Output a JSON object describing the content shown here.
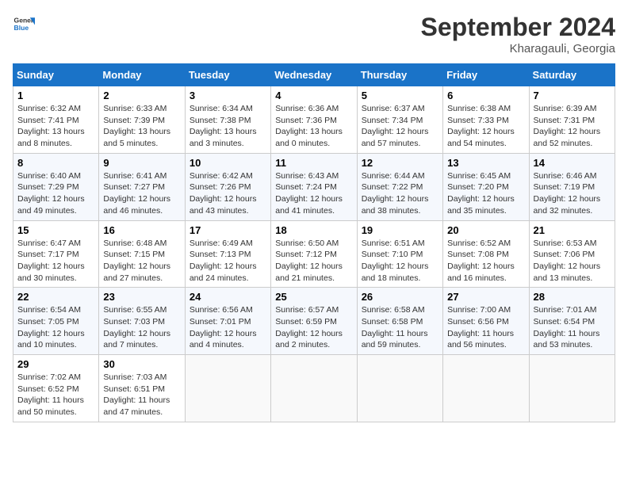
{
  "header": {
    "logo_line1": "General",
    "logo_line2": "Blue",
    "month_title": "September 2024",
    "subtitle": "Kharagauli, Georgia"
  },
  "weekdays": [
    "Sunday",
    "Monday",
    "Tuesday",
    "Wednesday",
    "Thursday",
    "Friday",
    "Saturday"
  ],
  "weeks": [
    [
      {
        "day": "1",
        "info": "Sunrise: 6:32 AM\nSunset: 7:41 PM\nDaylight: 13 hours and 8 minutes."
      },
      {
        "day": "2",
        "info": "Sunrise: 6:33 AM\nSunset: 7:39 PM\nDaylight: 13 hours and 5 minutes."
      },
      {
        "day": "3",
        "info": "Sunrise: 6:34 AM\nSunset: 7:38 PM\nDaylight: 13 hours and 3 minutes."
      },
      {
        "day": "4",
        "info": "Sunrise: 6:36 AM\nSunset: 7:36 PM\nDaylight: 13 hours and 0 minutes."
      },
      {
        "day": "5",
        "info": "Sunrise: 6:37 AM\nSunset: 7:34 PM\nDaylight: 12 hours and 57 minutes."
      },
      {
        "day": "6",
        "info": "Sunrise: 6:38 AM\nSunset: 7:33 PM\nDaylight: 12 hours and 54 minutes."
      },
      {
        "day": "7",
        "info": "Sunrise: 6:39 AM\nSunset: 7:31 PM\nDaylight: 12 hours and 52 minutes."
      }
    ],
    [
      {
        "day": "8",
        "info": "Sunrise: 6:40 AM\nSunset: 7:29 PM\nDaylight: 12 hours and 49 minutes."
      },
      {
        "day": "9",
        "info": "Sunrise: 6:41 AM\nSunset: 7:27 PM\nDaylight: 12 hours and 46 minutes."
      },
      {
        "day": "10",
        "info": "Sunrise: 6:42 AM\nSunset: 7:26 PM\nDaylight: 12 hours and 43 minutes."
      },
      {
        "day": "11",
        "info": "Sunrise: 6:43 AM\nSunset: 7:24 PM\nDaylight: 12 hours and 41 minutes."
      },
      {
        "day": "12",
        "info": "Sunrise: 6:44 AM\nSunset: 7:22 PM\nDaylight: 12 hours and 38 minutes."
      },
      {
        "day": "13",
        "info": "Sunrise: 6:45 AM\nSunset: 7:20 PM\nDaylight: 12 hours and 35 minutes."
      },
      {
        "day": "14",
        "info": "Sunrise: 6:46 AM\nSunset: 7:19 PM\nDaylight: 12 hours and 32 minutes."
      }
    ],
    [
      {
        "day": "15",
        "info": "Sunrise: 6:47 AM\nSunset: 7:17 PM\nDaylight: 12 hours and 30 minutes."
      },
      {
        "day": "16",
        "info": "Sunrise: 6:48 AM\nSunset: 7:15 PM\nDaylight: 12 hours and 27 minutes."
      },
      {
        "day": "17",
        "info": "Sunrise: 6:49 AM\nSunset: 7:13 PM\nDaylight: 12 hours and 24 minutes."
      },
      {
        "day": "18",
        "info": "Sunrise: 6:50 AM\nSunset: 7:12 PM\nDaylight: 12 hours and 21 minutes."
      },
      {
        "day": "19",
        "info": "Sunrise: 6:51 AM\nSunset: 7:10 PM\nDaylight: 12 hours and 18 minutes."
      },
      {
        "day": "20",
        "info": "Sunrise: 6:52 AM\nSunset: 7:08 PM\nDaylight: 12 hours and 16 minutes."
      },
      {
        "day": "21",
        "info": "Sunrise: 6:53 AM\nSunset: 7:06 PM\nDaylight: 12 hours and 13 minutes."
      }
    ],
    [
      {
        "day": "22",
        "info": "Sunrise: 6:54 AM\nSunset: 7:05 PM\nDaylight: 12 hours and 10 minutes."
      },
      {
        "day": "23",
        "info": "Sunrise: 6:55 AM\nSunset: 7:03 PM\nDaylight: 12 hours and 7 minutes."
      },
      {
        "day": "24",
        "info": "Sunrise: 6:56 AM\nSunset: 7:01 PM\nDaylight: 12 hours and 4 minutes."
      },
      {
        "day": "25",
        "info": "Sunrise: 6:57 AM\nSunset: 6:59 PM\nDaylight: 12 hours and 2 minutes."
      },
      {
        "day": "26",
        "info": "Sunrise: 6:58 AM\nSunset: 6:58 PM\nDaylight: 11 hours and 59 minutes."
      },
      {
        "day": "27",
        "info": "Sunrise: 7:00 AM\nSunset: 6:56 PM\nDaylight: 11 hours and 56 minutes."
      },
      {
        "day": "28",
        "info": "Sunrise: 7:01 AM\nSunset: 6:54 PM\nDaylight: 11 hours and 53 minutes."
      }
    ],
    [
      {
        "day": "29",
        "info": "Sunrise: 7:02 AM\nSunset: 6:52 PM\nDaylight: 11 hours and 50 minutes."
      },
      {
        "day": "30",
        "info": "Sunrise: 7:03 AM\nSunset: 6:51 PM\nDaylight: 11 hours and 47 minutes."
      },
      {
        "day": "",
        "info": ""
      },
      {
        "day": "",
        "info": ""
      },
      {
        "day": "",
        "info": ""
      },
      {
        "day": "",
        "info": ""
      },
      {
        "day": "",
        "info": ""
      }
    ]
  ]
}
